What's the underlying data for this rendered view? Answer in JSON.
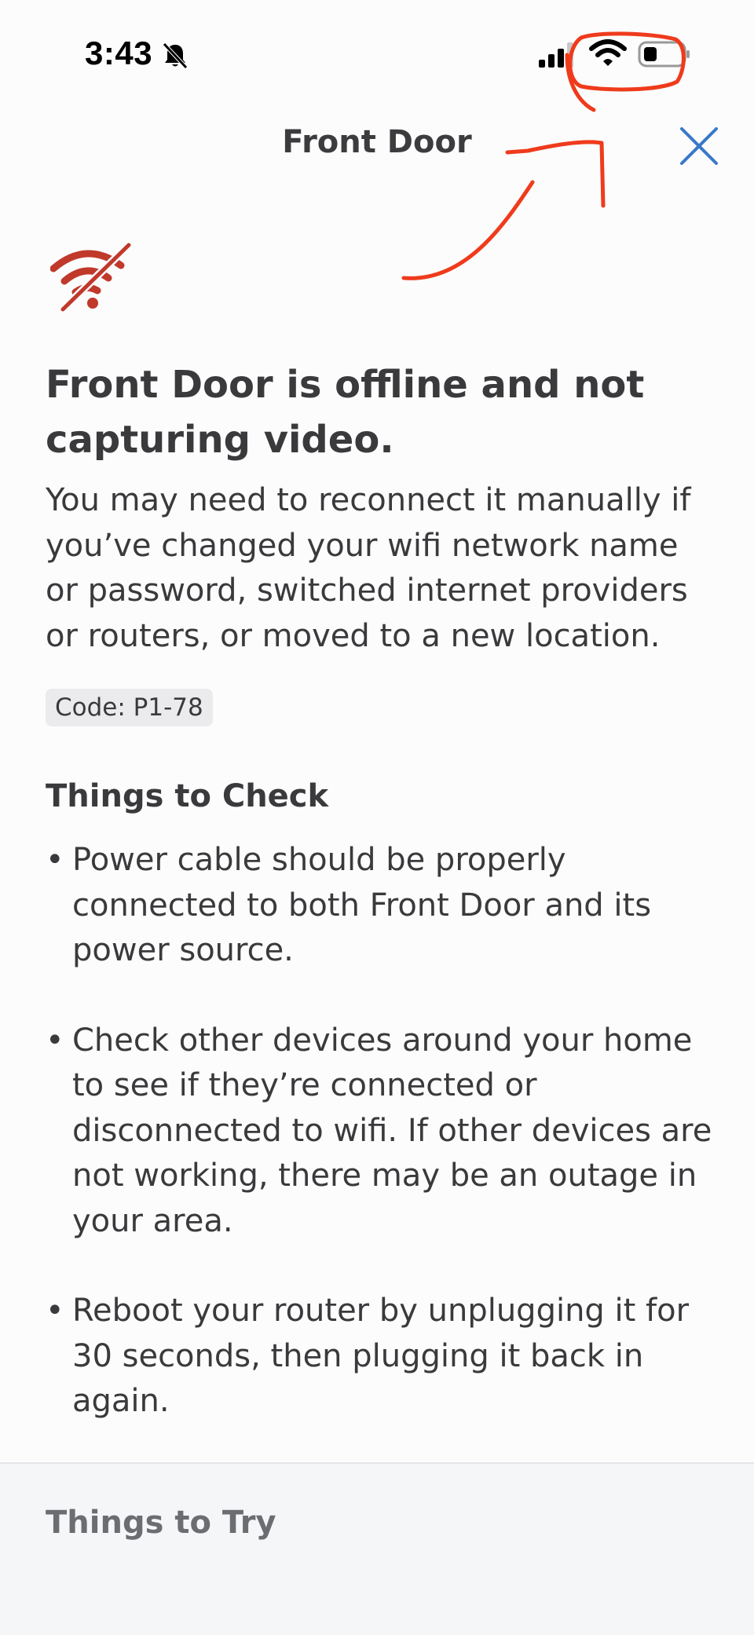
{
  "status_bar": {
    "time": "3:43",
    "icons": [
      "bell-slash-icon",
      "cellular-signal-icon",
      "wifi-icon",
      "battery-icon"
    ]
  },
  "header": {
    "title": "Front Door",
    "close_icon": "close-icon"
  },
  "alert": {
    "icon": "wifi-offline-icon",
    "headline": "Front Door is offline and not capturing video.",
    "description": "You may need to reconnect it manually if you’ve changed your wifi network name or password, switched internet providers or routers, or moved to a new location.",
    "code": "Code: P1-78"
  },
  "things_to_check": {
    "title": "Things to Check",
    "items": [
      "Power cable should be properly connected to both Front Door and its power source.",
      "Check other devices around your home to see if they’re connected or disconnected to wifi. If other devices are not working, there may be an outage in your area.",
      "Reboot your router by unplugging it for 30 seconds, then plugging it back in again."
    ]
  },
  "things_to_try": {
    "title": "Things to Try"
  },
  "colors": {
    "accent_close": "#3a78c9",
    "offline_red": "#c0392b",
    "annotation_red": "#ef3b1c"
  }
}
